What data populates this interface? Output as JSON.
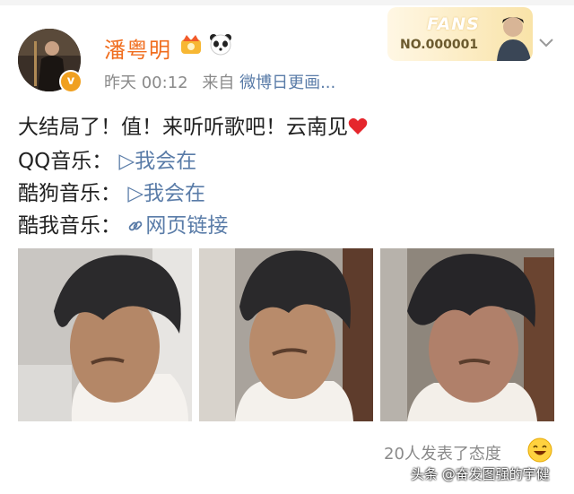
{
  "post": {
    "author_name": "潘粤明",
    "time": "昨天 00:12",
    "source_prefix": "来自",
    "source": "微博日更画...",
    "line1": "大结局了！值！来听听歌吧！云南见",
    "qq_label": "QQ音乐：",
    "qq_link": "▷我会在",
    "kugou_label": "酷狗音乐：",
    "kugou_link": "▷我会在",
    "kuwo_label": "酷我音乐：",
    "kuwo_link": "网页链接",
    "reactions": "20人发表了态度"
  },
  "fans_badge": {
    "label": "FANS",
    "number": "NO.000001"
  },
  "watermark": "头条 @奋发图强的宇健",
  "icons": {
    "verified": "v-badge-icon",
    "vip": "crown-vip-icon",
    "panda": "panda-icon",
    "heart": "red-heart-emoji",
    "link": "link-chain-icon",
    "smile": "laughing-emoji-icon",
    "chevron": "chevron-down-icon"
  },
  "colors": {
    "name": "#f06d1e",
    "link": "#5a7ca8",
    "meta": "#8a8a8a"
  }
}
